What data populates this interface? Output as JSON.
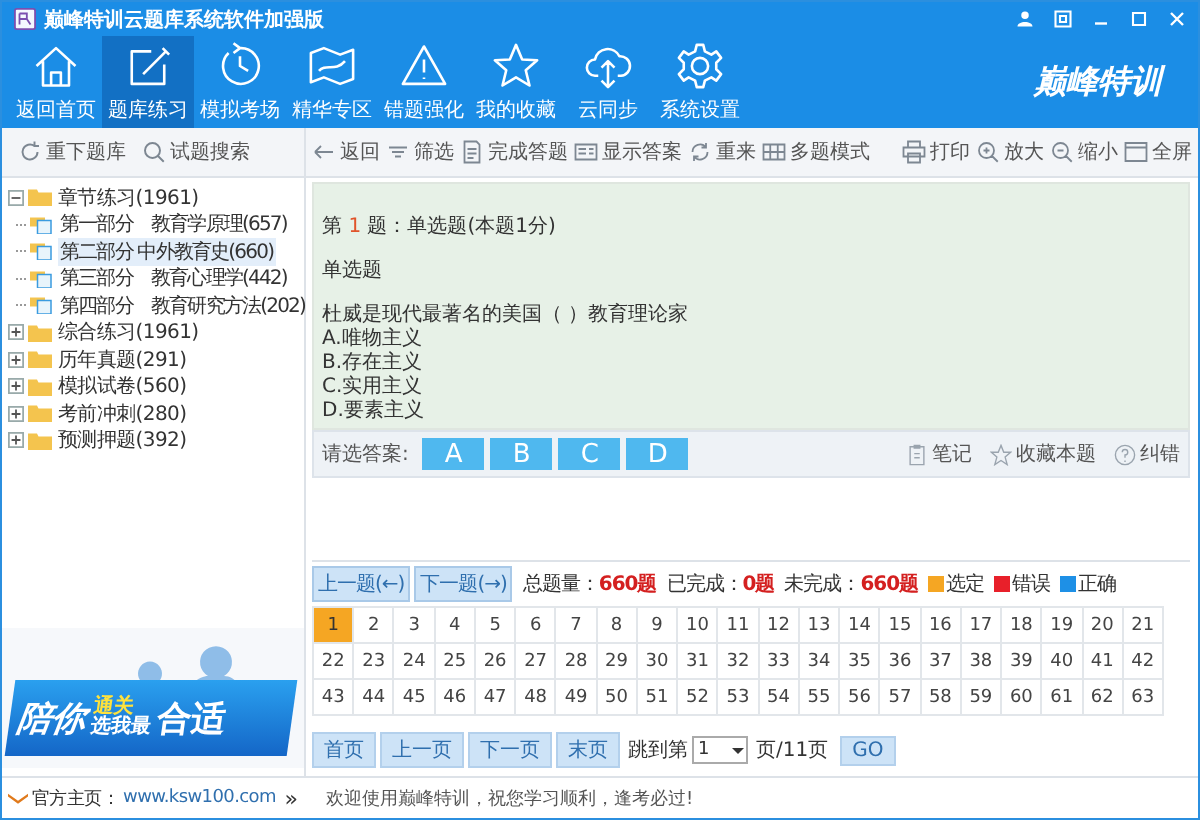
{
  "window": {
    "title": "巅峰特训云题库系统软件加强版"
  },
  "nav": [
    {
      "label": "返回首页",
      "selected": false
    },
    {
      "label": "题库练习",
      "selected": true
    },
    {
      "label": "模拟考场",
      "selected": false
    },
    {
      "label": "精华专区",
      "selected": false
    },
    {
      "label": "错题强化",
      "selected": false
    },
    {
      "label": "我的收藏",
      "selected": false
    },
    {
      "label": "云同步",
      "selected": false
    },
    {
      "label": "系统设置",
      "selected": false
    }
  ],
  "logo": "巅峰特训",
  "left_tools": [
    "重下题库",
    "试题搜索"
  ],
  "tools": [
    "返回",
    "筛选",
    "完成答题",
    "显示答案",
    "重来",
    "多题模式"
  ],
  "tools_right": [
    "打印",
    "放大",
    "缩小",
    "全屏"
  ],
  "tree": [
    {
      "label": "章节练习(1961)",
      "expanded": true,
      "children": [
        {
          "label": "第一部分　教育学原理(657)",
          "selected": false
        },
        {
          "label": "第二部分 中外教育史(660)",
          "selected": true
        },
        {
          "label": "第三部分　教育心理学(442)",
          "selected": false
        },
        {
          "label": "第四部分　教育研究方法(202)",
          "selected": false
        }
      ]
    },
    {
      "label": "综合练习(1961)",
      "expanded": false
    },
    {
      "label": "历年真题(291)",
      "expanded": false
    },
    {
      "label": "模拟试卷(560)",
      "expanded": false
    },
    {
      "label": "考前冲刺(280)",
      "expanded": false
    },
    {
      "label": "预测押题(392)",
      "expanded": false
    }
  ],
  "banner": {
    "text_1": "陪你",
    "text_2": "通关",
    "text_3": "选我最",
    "text_4": "合适"
  },
  "question": {
    "prefix": "第",
    "number": "1",
    "suffix": "题：单选题(本题1分)",
    "type": "单选题",
    "stem": "杜威是现代最著名的美国（ ）教育理论家",
    "options": [
      "A.唯物主义",
      "B.存在主义",
      "C.实用主义",
      "D.要素主义"
    ]
  },
  "answer": {
    "label": "请选答案:",
    "choices": [
      "A",
      "B",
      "C",
      "D"
    ],
    "actions": [
      "笔记",
      "收藏本题",
      "纠错"
    ]
  },
  "prev_question": "上一题(←)",
  "next_question": "下一题(→)",
  "stats": [
    {
      "label": "总题量：",
      "value": "660题"
    },
    {
      "label": "已完成：",
      "value": "0题"
    },
    {
      "label": "未完成：",
      "value": "660题"
    }
  ],
  "legend": [
    {
      "label": "选定",
      "color": "#f5a623"
    },
    {
      "label": "错误",
      "color": "#e8202a"
    },
    {
      "label": "正确",
      "color": "#1e90e6"
    }
  ],
  "grid": [
    {
      "label": "1",
      "selected": true
    },
    {
      "label": "2",
      "selected": false
    },
    {
      "label": "3",
      "selected": false
    },
    {
      "label": "4",
      "selected": false
    },
    {
      "label": "5",
      "selected": false
    },
    {
      "label": "6",
      "selected": false
    },
    {
      "label": "7",
      "selected": false
    },
    {
      "label": "8",
      "selected": false
    },
    {
      "label": "9",
      "selected": false
    },
    {
      "label": "10",
      "selected": false
    },
    {
      "label": "11",
      "selected": false
    },
    {
      "label": "12",
      "selected": false
    },
    {
      "label": "13",
      "selected": false
    },
    {
      "label": "14",
      "selected": false
    },
    {
      "label": "15",
      "selected": false
    },
    {
      "label": "16",
      "selected": false
    },
    {
      "label": "17",
      "selected": false
    },
    {
      "label": "18",
      "selected": false
    },
    {
      "label": "19",
      "selected": false
    },
    {
      "label": "20",
      "selected": false
    },
    {
      "label": "21",
      "selected": false
    },
    {
      "label": "22",
      "selected": false
    },
    {
      "label": "23",
      "selected": false
    },
    {
      "label": "24",
      "selected": false
    },
    {
      "label": "25",
      "selected": false
    },
    {
      "label": "26",
      "selected": false
    },
    {
      "label": "27",
      "selected": false
    },
    {
      "label": "28",
      "selected": false
    },
    {
      "label": "29",
      "selected": false
    },
    {
      "label": "30",
      "selected": false
    },
    {
      "label": "31",
      "selected": false
    },
    {
      "label": "32",
      "selected": false
    },
    {
      "label": "33",
      "selected": false
    },
    {
      "label": "34",
      "selected": false
    },
    {
      "label": "35",
      "selected": false
    },
    {
      "label": "36",
      "selected": false
    },
    {
      "label": "37",
      "selected": false
    },
    {
      "label": "38",
      "selected": false
    },
    {
      "label": "39",
      "selected": false
    },
    {
      "label": "40",
      "selected": false
    },
    {
      "label": "41",
      "selected": false
    },
    {
      "label": "42",
      "selected": false
    },
    {
      "label": "43",
      "selected": false
    },
    {
      "label": "44",
      "selected": false
    },
    {
      "label": "45",
      "selected": false
    },
    {
      "label": "46",
      "selected": false
    },
    {
      "label": "47",
      "selected": false
    },
    {
      "label": "48",
      "selected": false
    },
    {
      "label": "49",
      "selected": false
    },
    {
      "label": "50",
      "selected": false
    },
    {
      "label": "51",
      "selected": false
    },
    {
      "label": "52",
      "selected": false
    },
    {
      "label": "53",
      "selected": false
    },
    {
      "label": "54",
      "selected": false
    },
    {
      "label": "55",
      "selected": false
    },
    {
      "label": "56",
      "selected": false
    },
    {
      "label": "57",
      "selected": false
    },
    {
      "label": "58",
      "selected": false
    },
    {
      "label": "59",
      "selected": false
    },
    {
      "label": "60",
      "selected": false
    },
    {
      "label": "61",
      "selected": false
    },
    {
      "label": "62",
      "selected": false
    },
    {
      "label": "63",
      "selected": false
    }
  ],
  "pager": {
    "buttons": [
      "首页",
      "上一页",
      "下一页",
      "末页"
    ],
    "jump_label": "跳到第",
    "page_value": "1",
    "page_total": "页/11页",
    "go": "GO"
  },
  "footer": {
    "home_label": "官方主页：",
    "home_link": "www.ksw100.com",
    "more": "»",
    "welcome": "欢迎使用巅峰特训，祝您学习顺利，逢考必过!"
  }
}
